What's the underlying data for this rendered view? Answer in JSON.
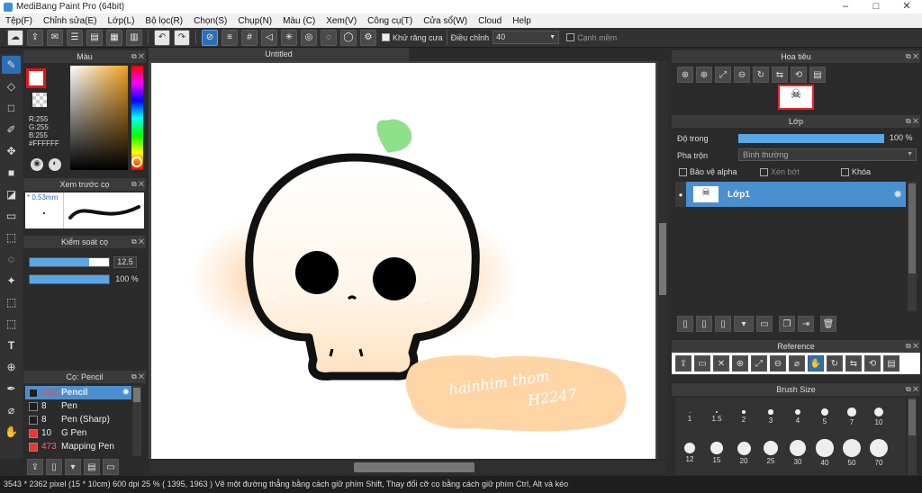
{
  "window": {
    "title": "MediBang Paint Pro (64bit)",
    "ctrl_min": "–",
    "ctrl_max": "□",
    "ctrl_close": "✕"
  },
  "menu": [
    "Tệp(F)",
    "Chỉnh sửa(E)",
    "Lớp(L)",
    "Bộ lọc(R)",
    "Chọn(S)",
    "Chụp(N)",
    "Màu (C)",
    "Xem(V)",
    "Công cụ(T)",
    "Cửa sổ(W)",
    "Cloud",
    "Help"
  ],
  "toolbar": {
    "antialias_label": "Khử răng cưa",
    "adjust_label": "Điều chỉnh",
    "adjust_value": "40",
    "smooth_label": "Cạnh mềm"
  },
  "color_panel": {
    "title": "Màu",
    "r": "R:255",
    "g": "G:255",
    "b": "B:255",
    "hex": "#FFFFFF"
  },
  "brush_preview": {
    "title": "Xem trước cọ",
    "size": "0.53mm"
  },
  "brush_control": {
    "title": "Kiểm soát cọ",
    "size_value": "12.5",
    "opacity_value": "100 %",
    "size_fraction": 0.75,
    "opacity_fraction": 1.0
  },
  "brush_list": {
    "title": "Cọ: Pencil",
    "items": [
      {
        "size": "12.5",
        "name": "Pencil",
        "selected": true,
        "swatch": "#1e1e1e"
      },
      {
        "size": "8",
        "name": "Pen",
        "selected": false,
        "swatch": "#1e1e1e"
      },
      {
        "size": "8",
        "name": "Pen (Sharp)",
        "selected": false,
        "swatch": "#1e1e1e"
      },
      {
        "size": "10",
        "name": "G Pen",
        "selected": false,
        "swatch": "#e53935"
      },
      {
        "size": "473",
        "name": "Mapping Pen",
        "selected": false,
        "swatch": "#e53935"
      }
    ]
  },
  "document": {
    "tab_title": "Untitled",
    "signature": "hainhim thom",
    "signature2": "H2247"
  },
  "navigator": {
    "title": "Hoa tiêu"
  },
  "layer_panel": {
    "title": "Lớp",
    "opacity_label": "Độ trong",
    "opacity_value": "100 %",
    "opacity_fraction": 1.0,
    "blend_label": "Pha trộn",
    "blend_value": "Bình thường",
    "protect_alpha": "Bảo vệ alpha",
    "clipping": "Xén bớt",
    "lock": "Khóa",
    "layer_name": "Lớp1"
  },
  "reference": {
    "title": "Reference"
  },
  "brush_size": {
    "title": "Brush Size",
    "row1": [
      "1",
      "1.5",
      "2",
      "3",
      "4",
      "5",
      "7",
      "10"
    ],
    "row2": [
      "12",
      "15",
      "20",
      "25",
      "30",
      "40",
      "50",
      "70"
    ]
  },
  "status": {
    "text": "3543 * 2362 pixel   (15 * 10cm)   600 dpi   25 %   ( 1395, 1963 )   Vẽ một đường thẳng bằng cách giữ phím Shift, Thay đổi cỡ cọ bằng cách giữ phím Ctrl, Alt và kéo"
  },
  "colors": {
    "accent": "#2d6fb5",
    "layer_selected": "#4a8fd0",
    "cheek": "#ffd9b3",
    "sprout": "#8ee08a"
  }
}
